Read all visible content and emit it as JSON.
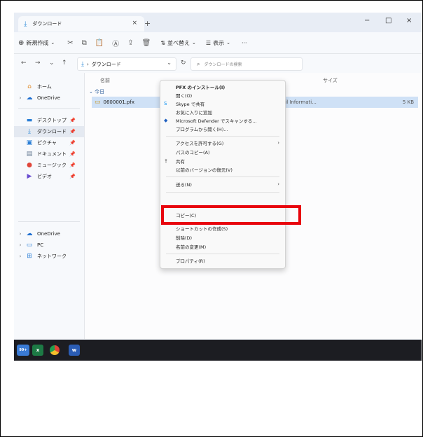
{
  "window": {
    "tab_title": "ダウンロード",
    "tab_close": "×",
    "new_tab": "+",
    "minimize": "−",
    "maximize": "□",
    "close": "×"
  },
  "toolbar": {
    "new_label": "新規作成",
    "sort_label": "並べ替え",
    "view_label": "表示",
    "more": "···"
  },
  "address": {
    "path": "ダウンロード",
    "search_placeholder": "ダウンロードの検索"
  },
  "sidebar": {
    "items": [
      {
        "label": "ホーム"
      },
      {
        "label": "OneDrive"
      },
      {
        "label": "デスクトップ"
      },
      {
        "label": "ダウンロード"
      },
      {
        "label": "ピクチャ"
      },
      {
        "label": "ドキュメント"
      },
      {
        "label": "ミュージック"
      },
      {
        "label": "ビデオ"
      },
      {
        "label": "OneDrive"
      },
      {
        "label": "PC"
      },
      {
        "label": "ネットワーク"
      }
    ]
  },
  "list": {
    "col_name": "名前",
    "col_size": "サイズ",
    "group": "今日",
    "file_name": "0600001.pfx",
    "file_type": "ail Informati...",
    "file_size": "5 KB"
  },
  "context_menu": {
    "items": [
      "PFX のインストール(I)",
      "開く(O)",
      "Skype で共有",
      "お気に入りに追加",
      "Microsoft Defender でスキャンする...",
      "プログラムから開く(H)...",
      "アクセスを許可する(G)",
      "パスのコピー(A)",
      "共有",
      "以前のバージョンの復元(V)",
      "送る(N)",
      "コピー(C)",
      "ショートカットの作成(S)",
      "削除(D)",
      "名前の変更(M)",
      "プロパティ(R)"
    ]
  },
  "taskbar": {
    "badge": "99+",
    "excel": "x",
    "word": "w"
  },
  "colors": {
    "accent": "#2d8ad8",
    "highlight": "#e8050e",
    "selection": "#cfe1f6"
  }
}
